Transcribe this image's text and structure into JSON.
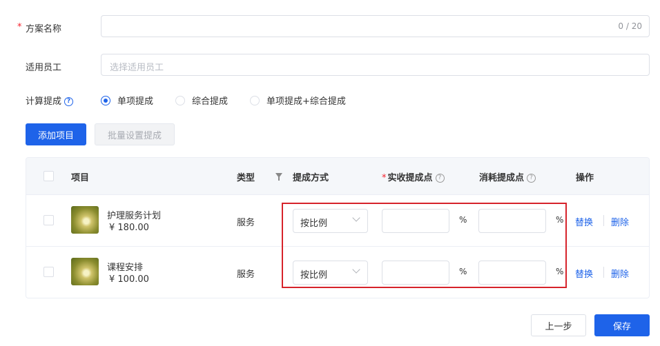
{
  "form": {
    "plan_name": {
      "label": "方案名称",
      "required_mark": "*",
      "counter": "0 / 20"
    },
    "staff": {
      "label": "适用员工",
      "placeholder": "选择适用员工"
    },
    "calc": {
      "label": "计算提成",
      "help": "?",
      "options": [
        {
          "label": "单项提成",
          "checked": true
        },
        {
          "label": "综合提成",
          "checked": false
        },
        {
          "label": "单项提成+综合提成",
          "checked": false
        }
      ]
    }
  },
  "toolbar": {
    "add_label": "添加项目",
    "batch_label": "批量设置提成"
  },
  "table": {
    "headers": {
      "item": "项目",
      "type": "类型",
      "method": "提成方式",
      "actual_required": "*",
      "actual": "实收提成点",
      "consume": "消耗提成点",
      "ops": "操作",
      "help": "?"
    },
    "rows": [
      {
        "name": "护理服务计划",
        "price": "¥ 180.00",
        "type": "服务",
        "method": "按比例",
        "pct_a": "%",
        "pct_b": "%",
        "replace": "替换",
        "delete": "删除"
      },
      {
        "name": "课程安排",
        "price": "¥ 100.00",
        "type": "服务",
        "method": "按比例",
        "pct_a": "%",
        "pct_b": "%",
        "replace": "替换",
        "delete": "删除"
      }
    ]
  },
  "footer": {
    "prev_label": "上一步",
    "save_label": "保存"
  },
  "colors": {
    "primary": "#1e63e9",
    "required": "#f5222d",
    "highlight": "#d6222a"
  },
  "icons": {
    "help": "question-circle-icon",
    "filter": "filter-icon",
    "chevron": "chevron-down-icon"
  }
}
